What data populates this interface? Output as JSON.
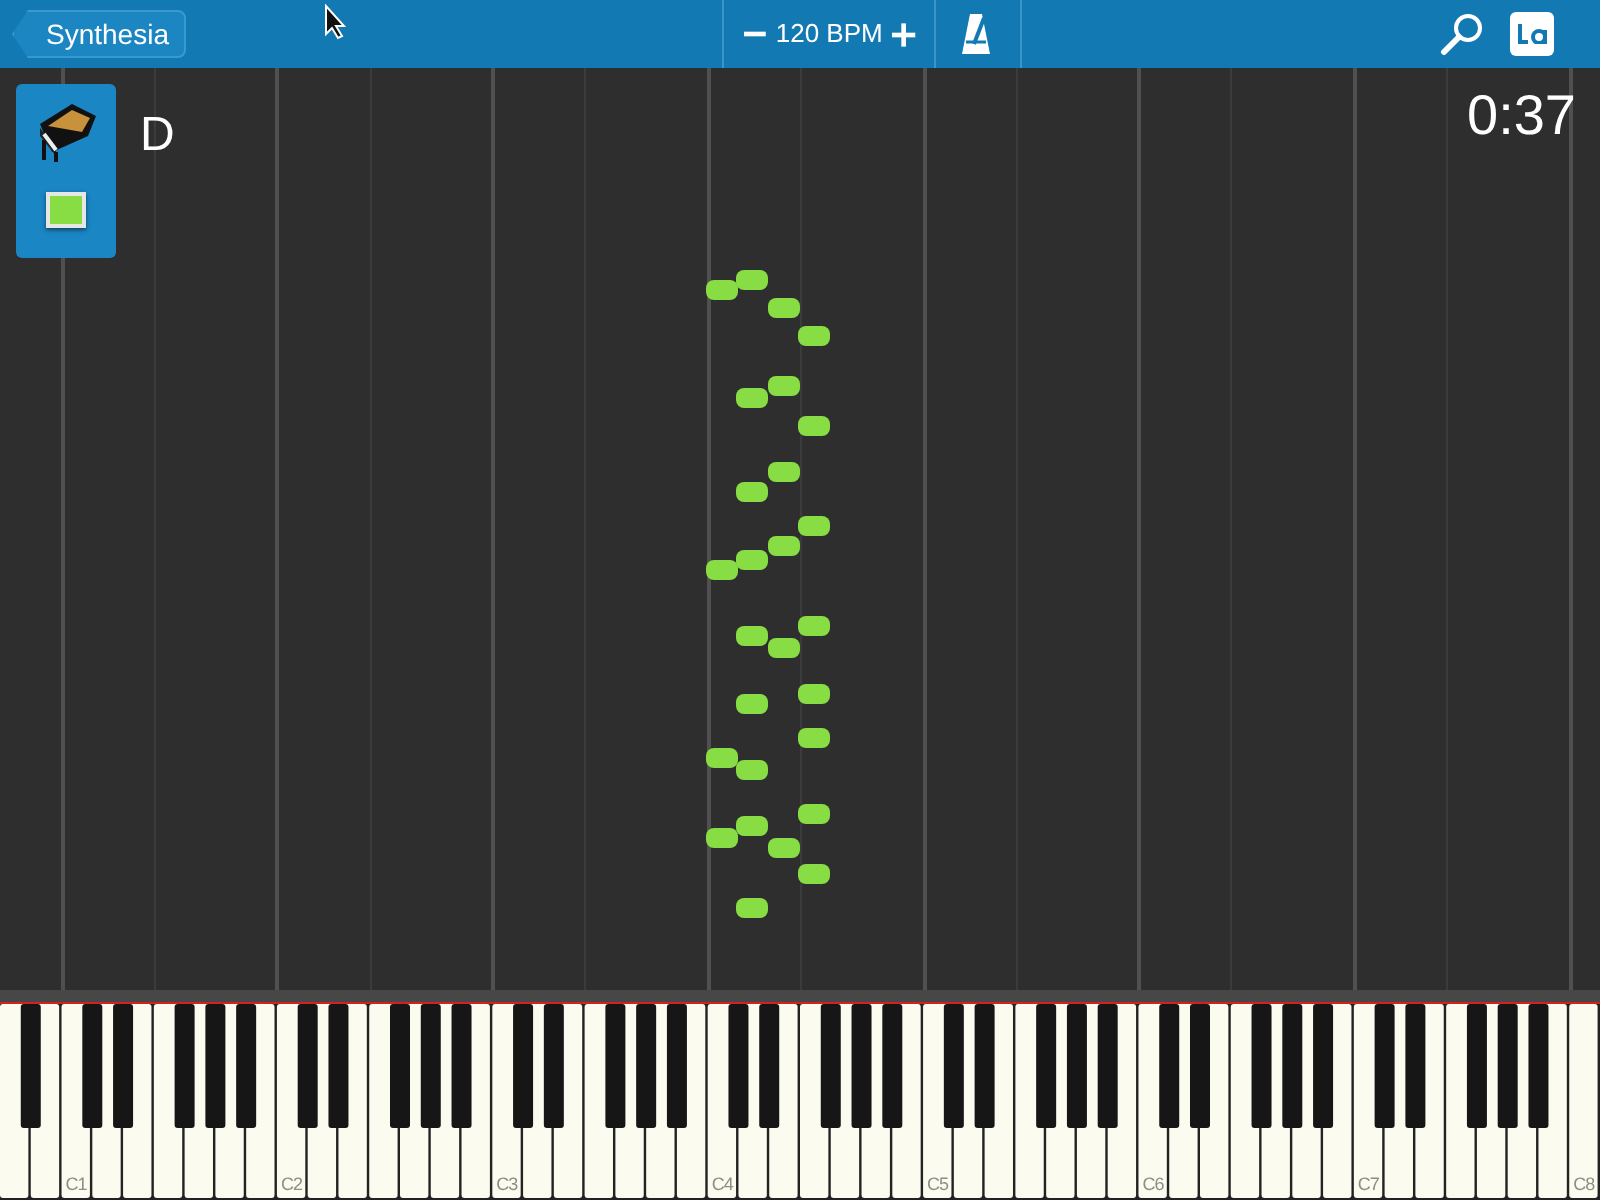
{
  "header": {
    "back_button": "Synthesia",
    "tempo": "120 BPM"
  },
  "track": {
    "color": "#88dd44",
    "key": "D"
  },
  "time": "0:37",
  "keyboard": {
    "c_labels": [
      "C1",
      "C2",
      "C3",
      "C4",
      "C5",
      "C6",
      "C7",
      "C8"
    ]
  }
}
